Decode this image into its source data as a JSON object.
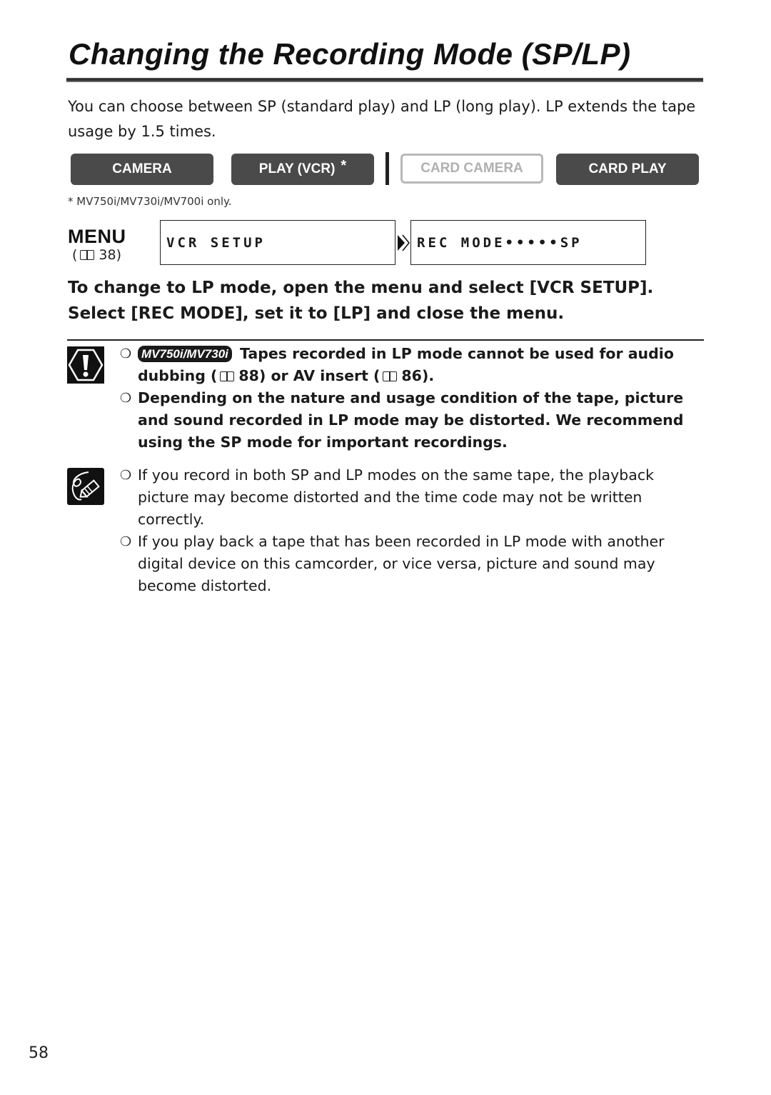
{
  "page": {
    "title": "Changing the Recording Mode (SP/LP)",
    "intro": "You can choose between SP (standard play) and LP (long play). LP extends the tape usage by 1.5 times.",
    "page_number": "58"
  },
  "modes": {
    "buttons": [
      {
        "label": "CAMERA",
        "state": "active"
      },
      {
        "label": "PLAY (VCR)",
        "state": "active",
        "marker": "*"
      },
      {
        "label": "CARD CAMERA",
        "state": "disabled"
      },
      {
        "label": "CARD PLAY",
        "state": "active"
      }
    ],
    "footnote": "* MV750i/MV730i/MV700i only."
  },
  "menu": {
    "label": "MENU",
    "ref_page": "38",
    "ref_open": "(",
    "ref_close": ")",
    "box1": "VCR SETUP",
    "box2": "REC MODE•••••SP"
  },
  "instruction": "To change to LP mode, open the menu and select [VCR SETUP]. Select [REC MODE], set it to [LP] and close the menu.",
  "caution": {
    "icon": "caution-icon",
    "items": [
      {
        "badge": "MV750i/MV730i",
        "text_a": "Tapes recorded in LP mode cannot be used for audio dubbing (",
        "ref1": "88",
        "text_b": ") or AV insert (",
        "ref2": "86",
        "text_c": ")."
      },
      {
        "text": "Depending on the nature and usage condition of the tape, picture and sound recorded in LP mode may be distorted. We recommend using the SP mode for important recordings."
      }
    ]
  },
  "notes": {
    "icon": "pencil-note-icon",
    "items": [
      {
        "text": "If you record in both SP and LP modes on the same tape, the playback picture may become distorted and the time code may not be written correctly."
      },
      {
        "text": "If you play back a tape that has been recorded in LP mode with another digital device on this camcorder, or vice versa, picture and sound may become distorted."
      }
    ]
  },
  "bullet_glyph": "❍"
}
